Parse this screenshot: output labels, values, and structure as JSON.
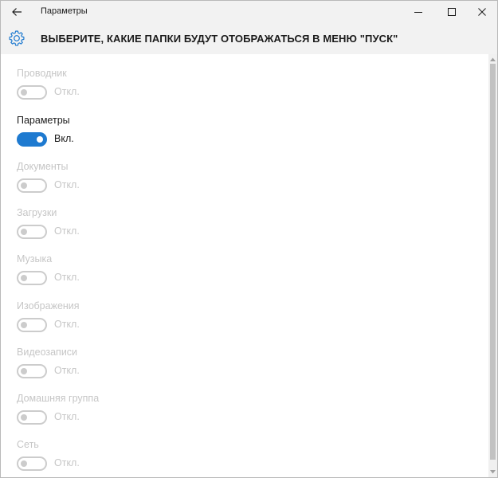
{
  "window": {
    "title": "Параметры"
  },
  "header": {
    "title": "ВЫБЕРИТЕ, КАКИЕ ПАПКИ БУДУТ ОТОБРАЖАТЬСЯ В МЕНЮ \"ПУСК\"",
    "icon": "gear-icon"
  },
  "settings": [
    {
      "label": "Проводник",
      "state": "Откл.",
      "on": false
    },
    {
      "label": "Параметры",
      "state": "Вкл.",
      "on": true
    },
    {
      "label": "Документы",
      "state": "Откл.",
      "on": false
    },
    {
      "label": "Загрузки",
      "state": "Откл.",
      "on": false
    },
    {
      "label": "Музыка",
      "state": "Откл.",
      "on": false
    },
    {
      "label": "Изображения",
      "state": "Откл.",
      "on": false
    },
    {
      "label": "Видеозаписи",
      "state": "Откл.",
      "on": false
    },
    {
      "label": "Домашняя группа",
      "state": "Откл.",
      "on": false
    },
    {
      "label": "Сеть",
      "state": "Откл.",
      "on": false
    }
  ],
  "colors": {
    "accent": "#1e7ad0",
    "disabled_text": "#c6c6c6",
    "titlebar_bg": "#f2f2f2"
  }
}
